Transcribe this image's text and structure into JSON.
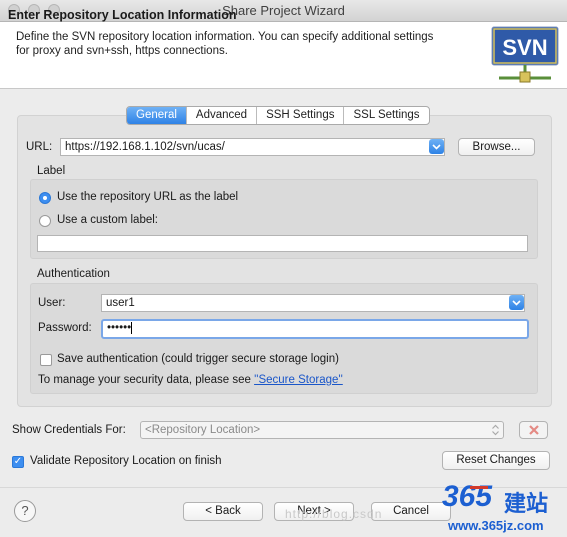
{
  "window": {
    "title": "Share Project Wizard"
  },
  "header": {
    "title": "Enter Repository Location Information",
    "description": "Define the SVN repository location information. You can specify additional settings for proxy and svn+ssh, https connections.",
    "logo_text": "SVN"
  },
  "tabs": [
    {
      "label": "General",
      "active": true
    },
    {
      "label": "Advanced",
      "active": false
    },
    {
      "label": "SSH Settings",
      "active": false
    },
    {
      "label": "SSL Settings",
      "active": false
    }
  ],
  "url": {
    "label": "URL:",
    "value": "https://192.168.1.102/svn/ucas/",
    "browse_label": "Browse..."
  },
  "label_group": {
    "title": "Label",
    "option_repo": "Use the repository URL as the label",
    "option_custom": "Use a custom label:",
    "custom_value": "",
    "selected": "repository_url"
  },
  "auth": {
    "title": "Authentication",
    "user_label": "User:",
    "user_value": "user1",
    "password_label": "Password:",
    "password_value": "••••••",
    "save_label": "Save authentication (could trigger secure storage login)",
    "save_checked": false,
    "manage_text": "To manage your security data, please see ",
    "manage_link": "''Secure Storage''"
  },
  "credentials": {
    "label": "Show Credentials For:",
    "value": "<Repository Location>"
  },
  "validate": {
    "label": "Validate Repository Location on finish",
    "checked": true
  },
  "reset_label": "Reset Changes",
  "footer": {
    "back_label": "< Back",
    "next_label": "Next >",
    "cancel_label": "Cancel"
  },
  "watermark": {
    "text": "http://blog.csdn",
    "brand_number": "365",
    "brand_chars": "建站",
    "brand_url": "www.365jz.com"
  },
  "colors": {
    "accent": "#3d8ef0",
    "link": "#1a56c9",
    "svn_logo_bg": "#2f5aa8",
    "brand_blue": "#1c5fd1",
    "brand_red": "#d33a2c"
  }
}
